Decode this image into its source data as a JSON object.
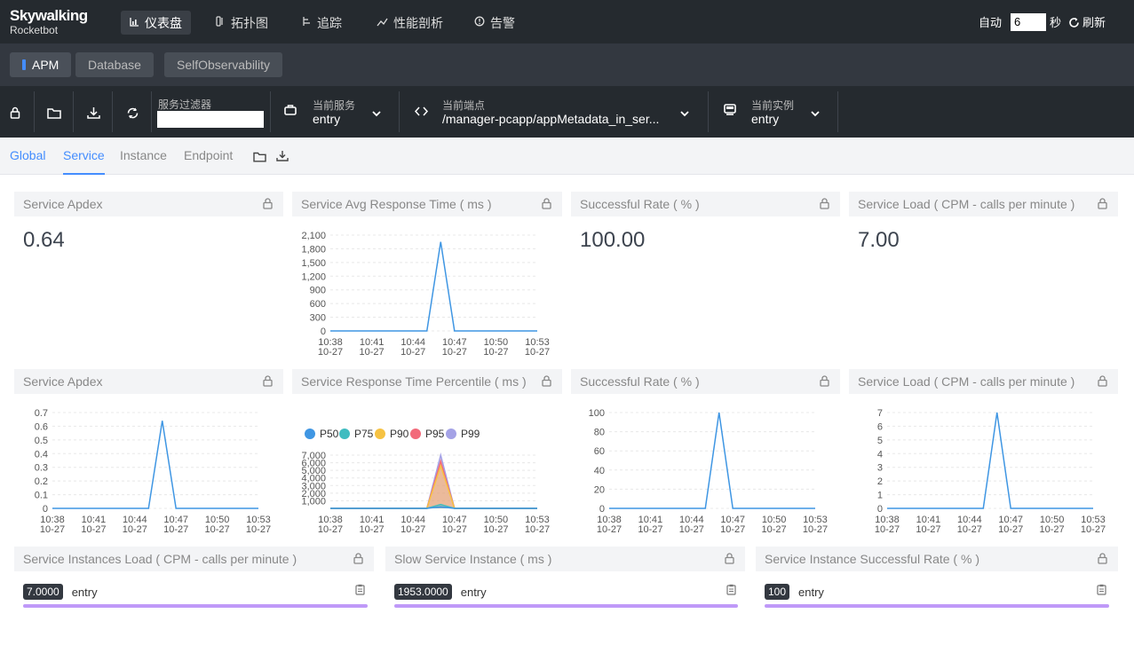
{
  "brand": {
    "name": "Skywalking",
    "sub": "Rocketbot"
  },
  "nav": [
    {
      "icon": "dashboard-icon",
      "label": "仪表盘",
      "active": true
    },
    {
      "icon": "topology-icon",
      "label": "拓扑图",
      "active": false
    },
    {
      "icon": "trace-icon",
      "label": "追踪",
      "active": false
    },
    {
      "icon": "profile-icon",
      "label": "性能剖析",
      "active": false
    },
    {
      "icon": "alarm-icon",
      "label": "告警",
      "active": false
    }
  ],
  "auto": {
    "label": "自动",
    "value": "6",
    "unit": "秒",
    "refresh": "刷新"
  },
  "tabs": [
    "APM",
    "Database",
    "SelfObservability"
  ],
  "toolbar": {
    "filter_label": "服务过滤器",
    "service_label": "当前服务",
    "service_value": "entry",
    "endpoint_label": "当前端点",
    "endpoint_value": "/manager-pcapp/appMetadata_in_ser...",
    "instance_label": "当前实例",
    "instance_value": "entry"
  },
  "subtabs": [
    "Global",
    "Service",
    "Instance",
    "Endpoint"
  ],
  "cards": {
    "apdex_title": "Service Apdex",
    "apdex_value": "0.64",
    "avg_rt_title": "Service Avg Response Time ( ms )",
    "success_title": "Successful Rate ( % )",
    "success_value": "100.00",
    "load_title": "Service Load ( CPM - calls per minute )",
    "load_value": "7.00",
    "apdex2_title": "Service Apdex",
    "percentile_title": "Service Response Time Percentile ( ms )",
    "success2_title": "Successful Rate ( % )",
    "load2_title": "Service Load ( CPM - calls per minute )",
    "inst_load_title": "Service Instances Load ( CPM - calls per minute )",
    "slow_inst_title": "Slow Service Instance ( ms )",
    "inst_success_title": "Service Instance Successful Rate ( % )"
  },
  "instances": [
    {
      "value": "7.0000",
      "name": "entry"
    },
    {
      "value": "1953.0000",
      "name": "entry"
    },
    {
      "value": "100",
      "name": "entry"
    }
  ],
  "colors": {
    "accent": "#448dfe",
    "line": "#3f96e3",
    "p50": "#3f96e3",
    "p75": "#3fbcc0",
    "p90": "#f6c242",
    "p95": "#f26a7a",
    "p99": "#a4a2e6",
    "instance_bar": "#bf99f8"
  },
  "chart_data": [
    {
      "type": "line",
      "title": "Service Avg Response Time ( ms )",
      "x": [
        "10:38\n10-27",
        "",
        "",
        "10:41\n10-27",
        "",
        "",
        "10:44\n10-27",
        "",
        "",
        "10:47\n10-27",
        "",
        "",
        "10:50\n10-27",
        "",
        "",
        "10:53\n10-27"
      ],
      "xticks": [
        "10:38",
        "10:41",
        "10:44",
        "10:47",
        "10:50",
        "10:53"
      ],
      "xsub": "10-27",
      "values": [
        0,
        0,
        0,
        0,
        0,
        0,
        0,
        0,
        1953,
        0,
        0,
        0,
        0,
        0,
        0,
        0
      ],
      "yticks": [
        "2,100",
        "1,800",
        "1,500",
        "1,200",
        "900",
        "600",
        "300",
        "0"
      ],
      "ylim": [
        0,
        2100
      ]
    },
    {
      "type": "line",
      "title": "Service Apdex",
      "values": [
        0,
        0,
        0,
        0,
        0,
        0,
        0,
        0,
        0.64,
        0,
        0,
        0,
        0,
        0,
        0,
        0
      ],
      "yticks": [
        "0.7",
        "0.6",
        "0.5",
        "0.4",
        "0.3",
        "0.2",
        "0.1",
        "0"
      ],
      "ylim": [
        0,
        0.7
      ]
    },
    {
      "type": "line",
      "title": "Service Response Time Percentile ( ms )",
      "legend": [
        "P50",
        "P75",
        "P90",
        "P95",
        "P99"
      ],
      "yticks": [
        "7,000",
        "6,000",
        "5,000",
        "4,000",
        "3,000",
        "2,000",
        "1,000"
      ],
      "ylim": [
        0,
        7000
      ],
      "series": [
        {
          "name": "P50",
          "values": [
            0,
            0,
            0,
            0,
            0,
            0,
            0,
            0,
            200,
            0,
            0,
            0,
            0,
            0,
            0,
            0
          ]
        },
        {
          "name": "P75",
          "values": [
            0,
            0,
            0,
            0,
            0,
            0,
            0,
            0,
            500,
            0,
            0,
            0,
            0,
            0,
            0,
            0
          ]
        },
        {
          "name": "P90",
          "values": [
            0,
            0,
            0,
            0,
            0,
            0,
            0,
            0,
            5600,
            0,
            0,
            0,
            0,
            0,
            0,
            0
          ]
        },
        {
          "name": "P95",
          "values": [
            0,
            0,
            0,
            0,
            0,
            0,
            0,
            0,
            6200,
            0,
            0,
            0,
            0,
            0,
            0,
            0
          ]
        },
        {
          "name": "P99",
          "values": [
            0,
            0,
            0,
            0,
            0,
            0,
            0,
            0,
            7000,
            0,
            0,
            0,
            0,
            0,
            0,
            0
          ]
        }
      ]
    },
    {
      "type": "line",
      "title": "Successful Rate ( % )",
      "values": [
        0,
        0,
        0,
        0,
        0,
        0,
        0,
        0,
        100,
        0,
        0,
        0,
        0,
        0,
        0,
        0
      ],
      "yticks": [
        "100",
        "80",
        "60",
        "40",
        "20",
        "0"
      ],
      "ylim": [
        0,
        100
      ]
    },
    {
      "type": "line",
      "title": "Service Load ( CPM - calls per minute )",
      "values": [
        0,
        0,
        0,
        0,
        0,
        0,
        0,
        0,
        7,
        0,
        0,
        0,
        0,
        0,
        0,
        0
      ],
      "yticks": [
        "7",
        "6",
        "5",
        "4",
        "3",
        "2",
        "1",
        "0"
      ],
      "ylim": [
        0,
        7
      ]
    }
  ]
}
